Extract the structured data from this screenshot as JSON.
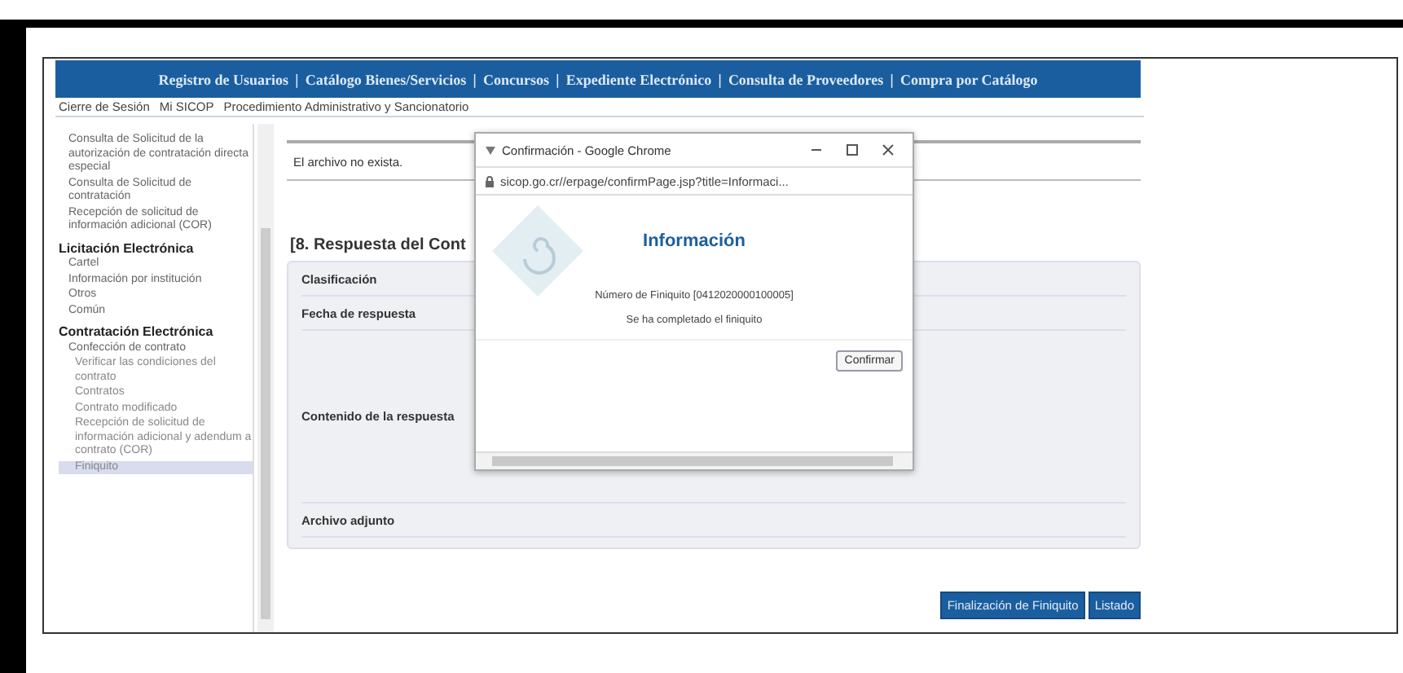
{
  "nav": {
    "links": [
      "Registro de Usuarios",
      "Catálogo Bienes/Servicios",
      "Concursos",
      "Expediente Electrónico",
      "Consulta de Proveedores",
      "Compra por Catálogo"
    ],
    "separator": "|"
  },
  "subnav": [
    "Cierre de Sesión",
    "Mi SICOP",
    "Procedimiento Administrativo y Sancionatorio"
  ],
  "sidebar": {
    "items": [
      {
        "kind": "item",
        "label": "Consulta de Solicitud de la autorización de contratación directa especial",
        "selected": false
      },
      {
        "kind": "item",
        "label": "Consulta de Solicitud de contratación",
        "selected": false
      },
      {
        "kind": "item",
        "label": "Recepción de solicitud de información adicional (COR)",
        "selected": false
      },
      {
        "kind": "section",
        "label": "Licitación Electrónica",
        "selected": false
      },
      {
        "kind": "item",
        "label": "Cartel",
        "selected": false
      },
      {
        "kind": "item",
        "label": "Información por institución",
        "selected": false
      },
      {
        "kind": "item",
        "label": "Otros",
        "selected": false
      },
      {
        "kind": "item",
        "label": "Común",
        "selected": false
      },
      {
        "kind": "section",
        "label": "Contratación Electrónica",
        "selected": false
      },
      {
        "kind": "item",
        "label": "Confección de contrato",
        "selected": false
      },
      {
        "kind": "sub",
        "label": "Verificar las condiciones del contrato",
        "selected": false
      },
      {
        "kind": "sub",
        "label": "Contratos",
        "selected": false
      },
      {
        "kind": "sub",
        "label": "Contrato modificado",
        "selected": false
      },
      {
        "kind": "sub",
        "label": "Recepción de solicitud de información adicional y adendum a contrato (COR)",
        "selected": false
      },
      {
        "kind": "sub",
        "label": "Finiquito",
        "selected": true
      }
    ]
  },
  "main": {
    "file_message": "El archivo no exista.",
    "section_title": "[8. Respuesta del Cont",
    "rows": [
      {
        "label": "Clasificación",
        "kind": "line"
      },
      {
        "label": "Fecha de respuesta",
        "kind": "line"
      },
      {
        "label": "Contenido de la respuesta",
        "kind": "textarea"
      },
      {
        "label": "Archivo adjunto",
        "kind": "line"
      }
    ],
    "buttons": [
      "Finalización de Finiquito",
      "Listado"
    ]
  },
  "dialog": {
    "title": "Confirmación - Google Chrome",
    "url": "sicop.go.cr//erpage/confirmPage.jsp?title=Informaci...",
    "heading": "Información",
    "number": "Número de Finiquito [0412020000100005]",
    "message": "Se ha completado el finiquito",
    "button": "Confirmar"
  }
}
